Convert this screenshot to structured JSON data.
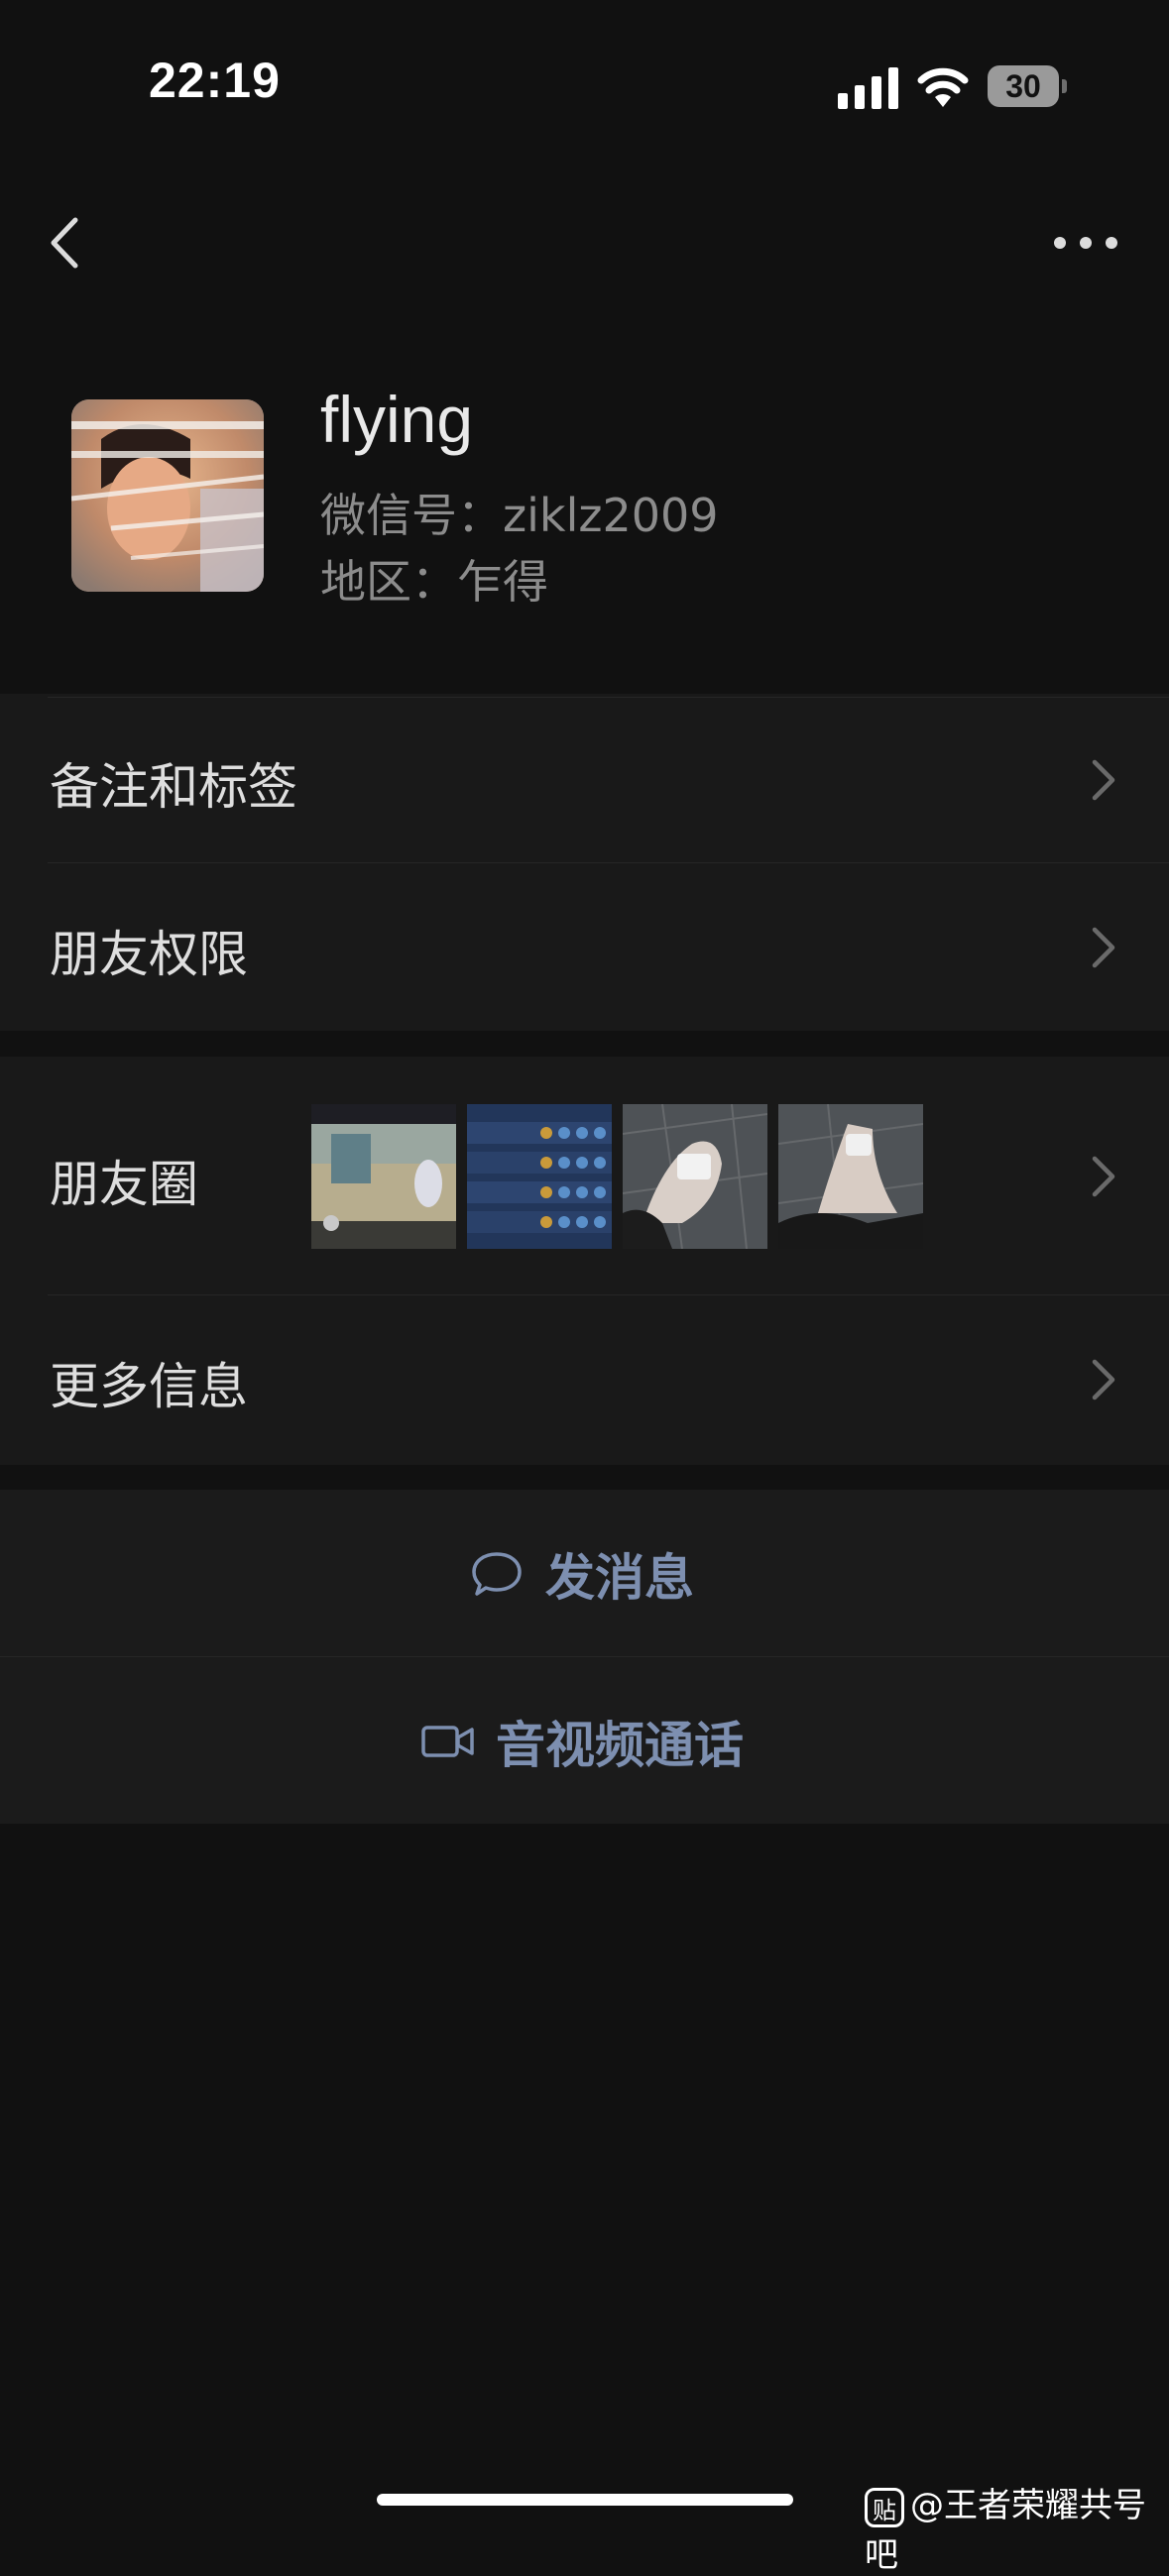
{
  "status_bar": {
    "time": "22:19",
    "battery": "30"
  },
  "profile": {
    "name": "flying",
    "wechat_id": "微信号：ziklz2009",
    "region": "地区：乍得"
  },
  "cells": {
    "remark_tags": "备注和标签",
    "friend_permissions": "朋友权限",
    "moments": "朋友圈",
    "more_info": "更多信息"
  },
  "actions": {
    "send_message": "发消息",
    "video_call": "音视频通话"
  },
  "watermark": {
    "badge": "贴",
    "text": "@王者荣耀共号吧"
  },
  "colors": {
    "background": "#111111",
    "cell": "#191919",
    "action_text": "#7d8fb0",
    "secondary_text": "#8c8c8c"
  }
}
